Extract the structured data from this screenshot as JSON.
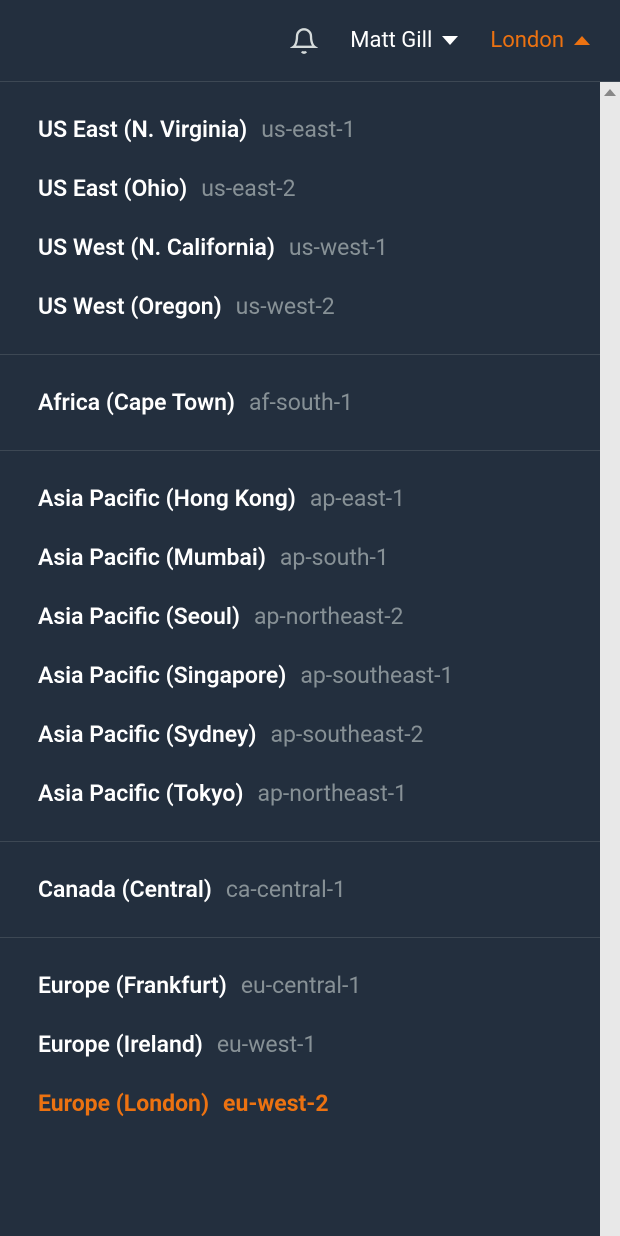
{
  "header": {
    "user_name": "Matt Gill",
    "region_label": "London"
  },
  "regions": {
    "groups": [
      {
        "items": [
          {
            "name": "US East (N. Virginia)",
            "code": "us-east-1",
            "selected": false
          },
          {
            "name": "US East (Ohio)",
            "code": "us-east-2",
            "selected": false
          },
          {
            "name": "US West (N. California)",
            "code": "us-west-1",
            "selected": false
          },
          {
            "name": "US West (Oregon)",
            "code": "us-west-2",
            "selected": false
          }
        ]
      },
      {
        "items": [
          {
            "name": "Africa (Cape Town)",
            "code": "af-south-1",
            "selected": false
          }
        ]
      },
      {
        "items": [
          {
            "name": "Asia Pacific (Hong Kong)",
            "code": "ap-east-1",
            "selected": false
          },
          {
            "name": "Asia Pacific (Mumbai)",
            "code": "ap-south-1",
            "selected": false
          },
          {
            "name": "Asia Pacific (Seoul)",
            "code": "ap-northeast-2",
            "selected": false
          },
          {
            "name": "Asia Pacific (Singapore)",
            "code": "ap-southeast-1",
            "selected": false
          },
          {
            "name": "Asia Pacific (Sydney)",
            "code": "ap-southeast-2",
            "selected": false
          },
          {
            "name": "Asia Pacific (Tokyo)",
            "code": "ap-northeast-1",
            "selected": false
          }
        ]
      },
      {
        "items": [
          {
            "name": "Canada (Central)",
            "code": "ca-central-1",
            "selected": false
          }
        ]
      },
      {
        "items": [
          {
            "name": "Europe (Frankfurt)",
            "code": "eu-central-1",
            "selected": false
          },
          {
            "name": "Europe (Ireland)",
            "code": "eu-west-1",
            "selected": false
          },
          {
            "name": "Europe (London)",
            "code": "eu-west-2",
            "selected": true
          }
        ]
      }
    ]
  }
}
